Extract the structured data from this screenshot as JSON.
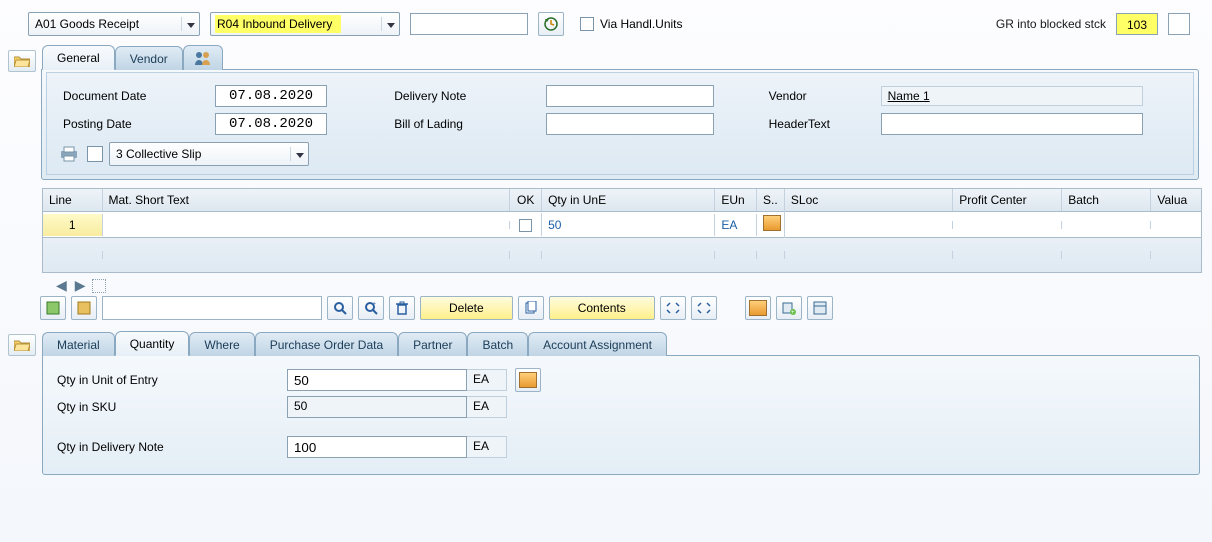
{
  "top": {
    "dd1": "A01 Goods Receipt",
    "dd2": "R04 Inbound Delivery",
    "via_label": "Via Handl.Units",
    "right_label": "GR into blocked stck",
    "code": "103"
  },
  "header_tabs": {
    "general": "General",
    "vendor": "Vendor"
  },
  "header_fields": {
    "doc_date_l": "Document Date",
    "doc_date_v": "07.08.2020",
    "post_date_l": "Posting Date",
    "post_date_v": "07.08.2020",
    "del_note_l": "Delivery Note",
    "bol_l": "Bill of Lading",
    "vendor_l": "Vendor",
    "vendor_v": "Name 1",
    "htext_l": "HeaderText",
    "print_opt": "3 Collective Slip"
  },
  "grid": {
    "cols": {
      "line": "Line",
      "mat": "Mat. Short Text",
      "ok": "OK",
      "qty": "Qty in UnE",
      "eun": "EUn",
      "s": "S..",
      "sloc": "SLoc",
      "pc": "Profit Center",
      "batch": "Batch",
      "val": "Valua"
    },
    "row1": {
      "line": "1",
      "qty": "50",
      "eun": "EA"
    }
  },
  "tb": {
    "delete": "Delete",
    "contents": "Contents"
  },
  "detail_tabs": {
    "material": "Material",
    "quantity": "Quantity",
    "where": "Where",
    "pod": "Purchase Order Data",
    "partner": "Partner",
    "batch": "Batch",
    "aa": "Account Assignment"
  },
  "detail": {
    "qty_ue_l": "Qty in Unit of Entry",
    "qty_ue_v": "50",
    "qty_ue_u": "EA",
    "qty_sku_l": "Qty in SKU",
    "qty_sku_v": "50",
    "qty_sku_u": "EA",
    "qty_dn_l": "Qty in Delivery Note",
    "qty_dn_v": "100",
    "qty_dn_u": "EA"
  }
}
